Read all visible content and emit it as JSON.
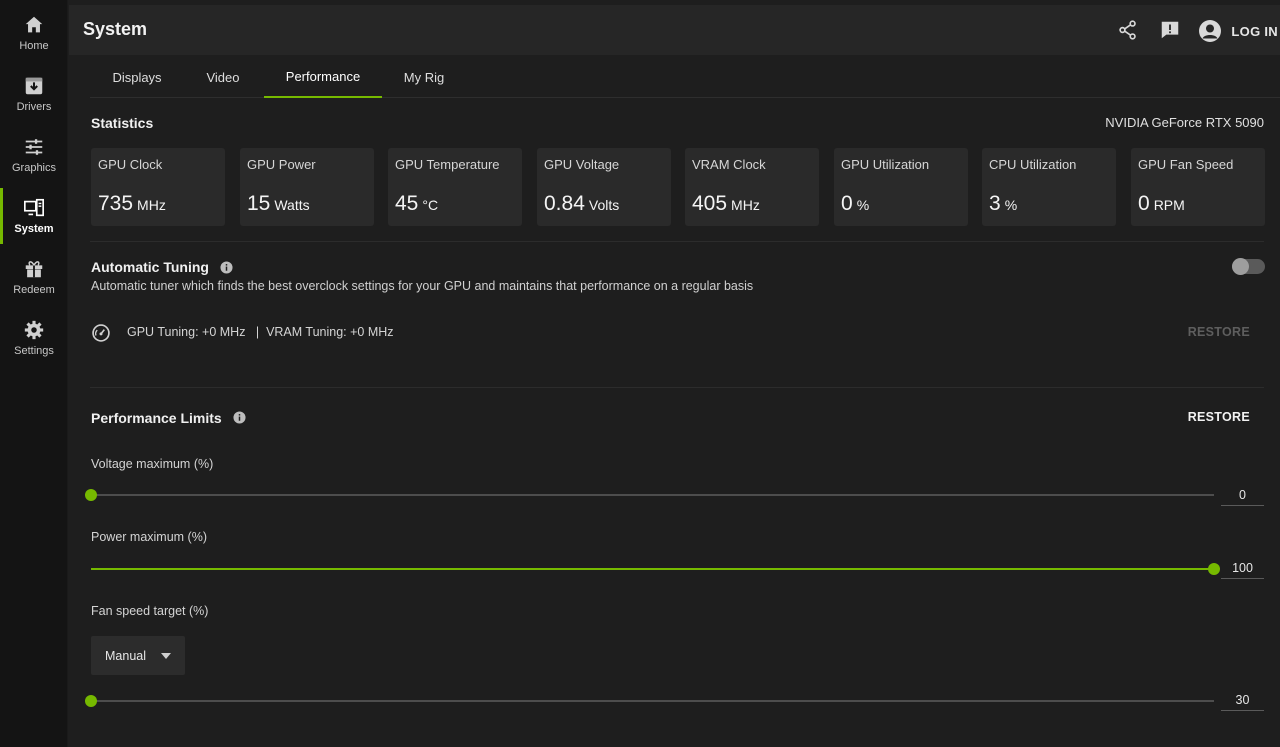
{
  "sidebar": {
    "items": [
      {
        "label": "Home",
        "icon": "home-icon",
        "active": false
      },
      {
        "label": "Drivers",
        "icon": "download-icon",
        "active": false
      },
      {
        "label": "Graphics",
        "icon": "sliders-icon",
        "active": false
      },
      {
        "label": "System",
        "icon": "system-icon",
        "active": true
      },
      {
        "label": "Redeem",
        "icon": "gift-icon",
        "active": false
      },
      {
        "label": "Settings",
        "icon": "gear-icon",
        "active": false
      }
    ]
  },
  "header": {
    "title": "System",
    "login_label": "LOG IN",
    "icons": [
      "share-icon",
      "feedback-icon",
      "user-avatar-icon"
    ]
  },
  "tabs": [
    {
      "label": "Displays",
      "active": false
    },
    {
      "label": "Video",
      "active": false
    },
    {
      "label": "Performance",
      "active": true
    },
    {
      "label": "My Rig",
      "active": false
    }
  ],
  "statistics": {
    "title": "Statistics",
    "gpu_name": "NVIDIA GeForce RTX 5090",
    "cards": [
      {
        "name": "GPU Clock",
        "value": "735",
        "unit": "MHz"
      },
      {
        "name": "GPU Power",
        "value": "15",
        "unit": "Watts"
      },
      {
        "name": "GPU Temperature",
        "value": "45",
        "unit": "°C"
      },
      {
        "name": "GPU Voltage",
        "value": "0.84",
        "unit": "Volts"
      },
      {
        "name": "VRAM Clock",
        "value": "405",
        "unit": "MHz"
      },
      {
        "name": "GPU Utilization",
        "value": "0",
        "unit": "%"
      },
      {
        "name": "CPU Utilization",
        "value": "3",
        "unit": "%"
      },
      {
        "name": "GPU Fan Speed",
        "value": "0",
        "unit": "RPM"
      }
    ]
  },
  "auto_tuning": {
    "title": "Automatic Tuning",
    "description": "Automatic tuner which finds the best overclock settings for your GPU and maintains that performance on a regular basis",
    "toggle_on": false,
    "tuning_info": "GPU Tuning: +0 MHz   |  VRAM Tuning: +0 MHz",
    "restore_label": "RESTORE"
  },
  "performance_limits": {
    "title": "Performance Limits",
    "restore_label": "RESTORE",
    "voltage": {
      "label": "Voltage maximum (%)",
      "value": "0",
      "fraction": 0.0
    },
    "power": {
      "label": "Power maximum (%)",
      "value": "100",
      "fraction": 1.0
    },
    "fan": {
      "label": "Fan speed target (%)",
      "mode": "Manual",
      "value": "30",
      "fraction": 0.0
    }
  },
  "colors": {
    "accent": "#76b900",
    "background": "#1e1e1e",
    "card": "#2a2a2a"
  }
}
